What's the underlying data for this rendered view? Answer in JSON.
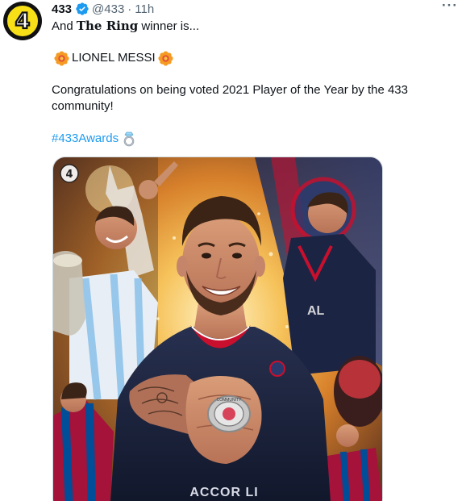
{
  "author": {
    "avatar_text": "4",
    "display_name": "433",
    "handle": "@433",
    "separator": "·",
    "time": "11h",
    "verified": true
  },
  "more_label": "···",
  "tweet": {
    "line1_prefix": "And ",
    "line1_bold": "The Ring",
    "line1_suffix": " winner is...",
    "headline": "LIONEL MESSI",
    "congrats": "Congratulations on being voted 2021 Player of the Year by the 433 community!",
    "hashtag": "#433Awards"
  },
  "media": {
    "watermark": "4",
    "shirt_sponsor": "ACCOR LI",
    "ring_text": "COMMUNITY"
  },
  "colors": {
    "accent": "#1d9bf0",
    "avatar_yellow": "#f7e017",
    "text_primary": "#0f1419",
    "text_secondary": "#536471"
  },
  "icons": {
    "verified": "verified-badge-icon",
    "flower": "flower-emoji-icon",
    "ring": "ring-emoji-icon",
    "more": "more-options-icon"
  }
}
